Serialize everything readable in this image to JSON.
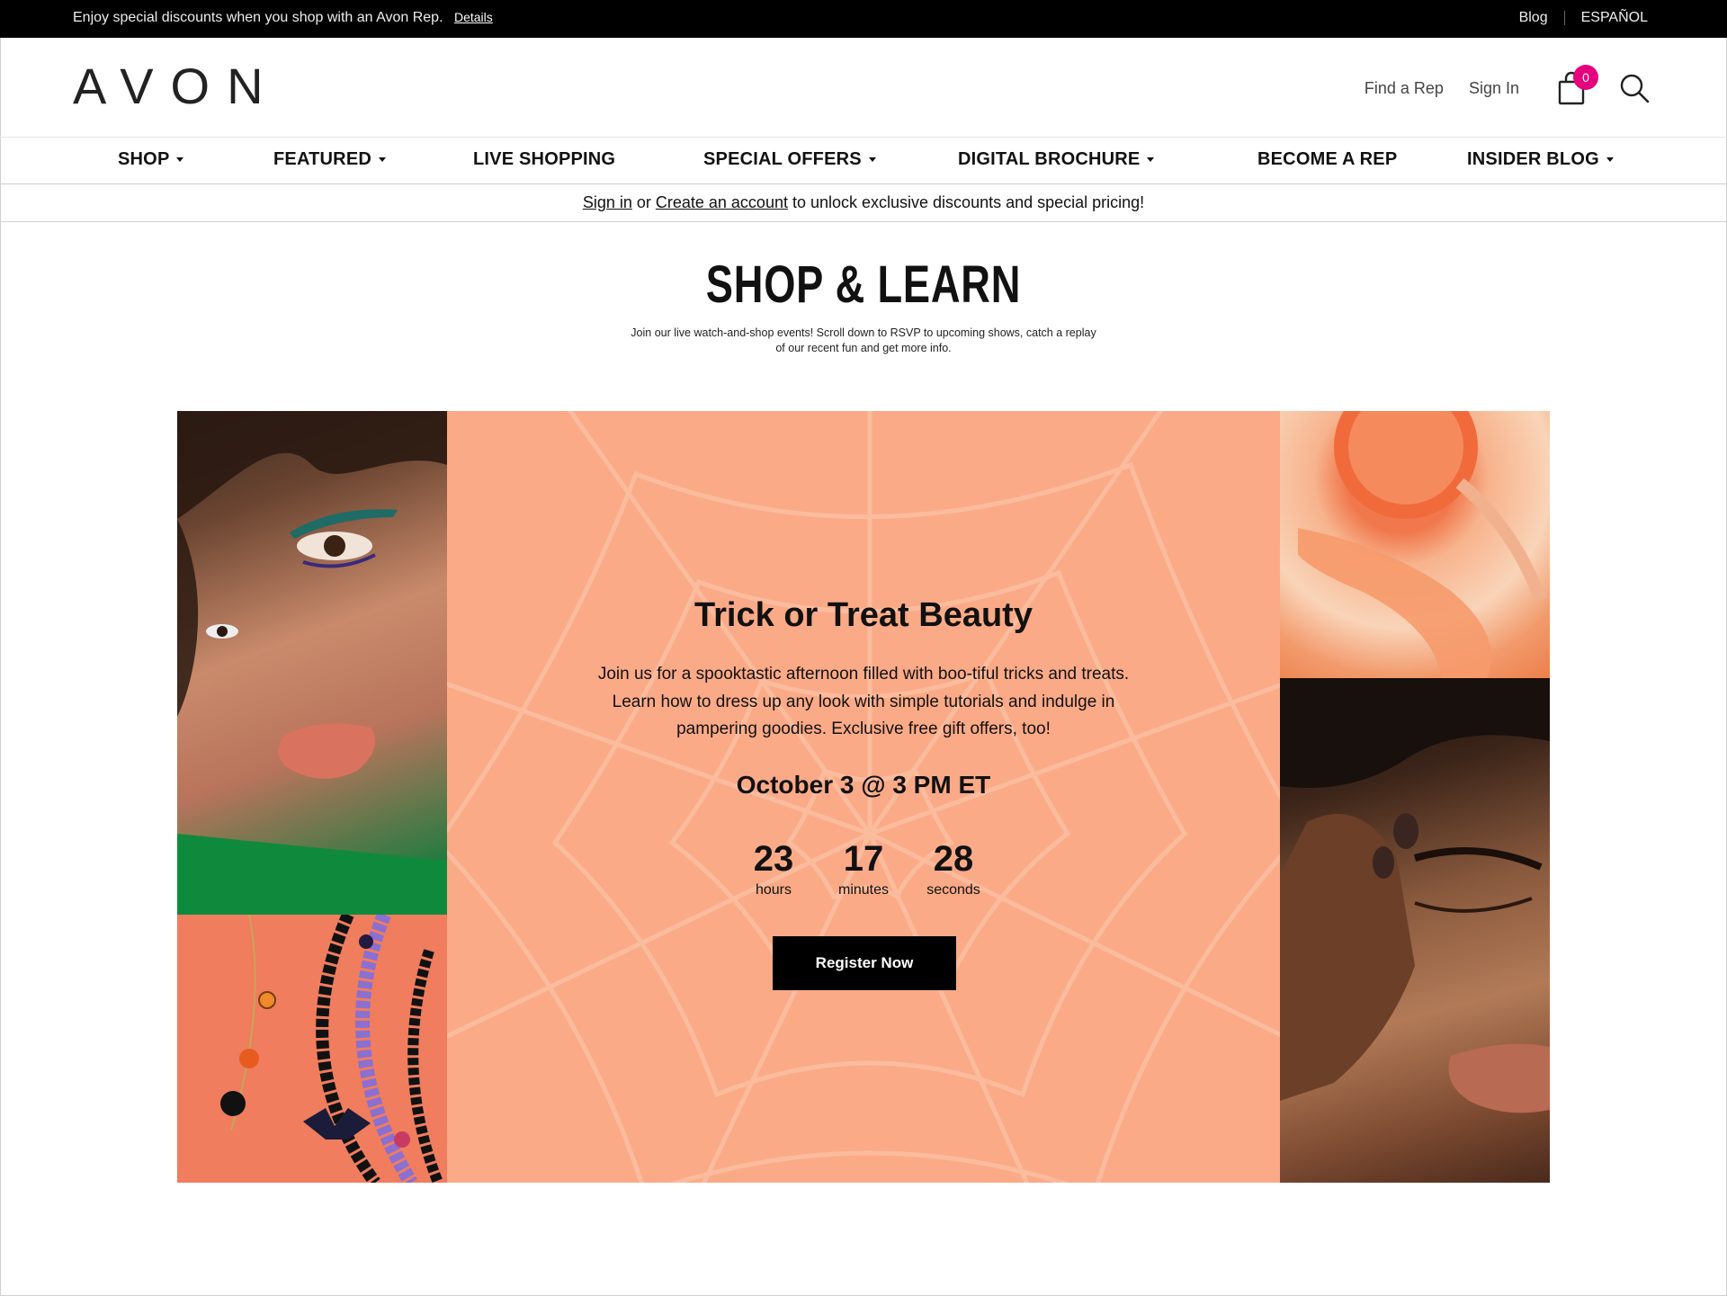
{
  "promo": {
    "message": "Enjoy special discounts when you shop with an Avon Rep.",
    "details_link": "Details",
    "blog_link": "Blog",
    "language_link": "ESPAÑOL"
  },
  "header": {
    "logo": "AVON",
    "find_rep": "Find a Rep",
    "sign_in": "Sign In",
    "cart_count": "0",
    "cart_icon": "shopping-bag-icon",
    "search_icon": "search-icon"
  },
  "nav": {
    "items": [
      {
        "label": "SHOP",
        "has_dropdown": true
      },
      {
        "label": "FEATURED",
        "has_dropdown": true
      },
      {
        "label": "LIVE SHOPPING",
        "has_dropdown": false
      },
      {
        "label": "SPECIAL OFFERS",
        "has_dropdown": true
      },
      {
        "label": "DIGITAL BROCHURE",
        "has_dropdown": true
      },
      {
        "label": "BECOME A REP",
        "has_dropdown": false
      },
      {
        "label": "INSIDER BLOG",
        "has_dropdown": true
      }
    ]
  },
  "signin_strip": {
    "sign_in_link": "Sign in",
    "or_text": " or ",
    "create_link": "Create an account",
    "rest_text": " to unlock exclusive discounts and special pricing!"
  },
  "page": {
    "title": "SHOP & LEARN",
    "intro_line1": "Join our live watch-and-shop events! Scroll down to RSVP to upcoming shows, catch a replay",
    "intro_line2": "of our recent fun and get more info."
  },
  "hero": {
    "title": "Trick or Treat Beauty",
    "description": "Join us for a spooktastic afternoon filled with boo-tiful tricks and treats. Learn how to dress up any look with simple tutorials and indulge in pampering goodies. Exclusive free gift offers, too!",
    "date": "October 3 @ 3 PM ET",
    "countdown": [
      {
        "value": "23",
        "unit": "hours"
      },
      {
        "value": "17",
        "unit": "minutes"
      },
      {
        "value": "28",
        "unit": "seconds"
      }
    ],
    "cta": "Register Now",
    "background_color": "#fbaa87"
  },
  "colors": {
    "brand_pink": "#e6007e",
    "promo_bar": "#000000",
    "hero_bg": "#fbaa87"
  }
}
